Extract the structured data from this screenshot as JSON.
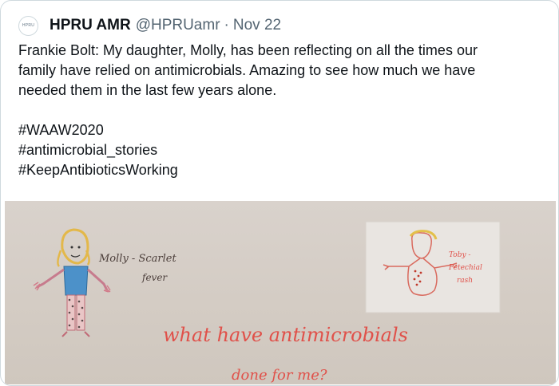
{
  "tweet": {
    "avatar_text": "HPRU",
    "display_name": "HPRU AMR",
    "handle": "@HPRUamr",
    "separator": "·",
    "date": "Nov 22",
    "text_lines": [
      "Frankie Bolt: My daughter, Molly, has been reflecting on all the times our",
      "family have relied on antimicrobials. Amazing to see how much we have",
      "needed them in the last few years alone."
    ],
    "hashtags": [
      "#WAAW2020",
      "#antimicrobial_stories",
      "#KeepAntibioticsWorking"
    ]
  },
  "drawing": {
    "molly_label_line1": "Molly - Scarlet",
    "molly_label_line2": "fever",
    "toby_label_line1": "Toby -",
    "toby_label_line2": "Petechial",
    "toby_label_line3": "rash",
    "heading_line1": "what have antimicrobials",
    "heading_line2": "done for me?"
  },
  "colors": {
    "text": "#0f1419",
    "muted": "#536471",
    "border": "#cfd9de",
    "marker_red": "#e0514a",
    "paper": "#d6cec6"
  }
}
